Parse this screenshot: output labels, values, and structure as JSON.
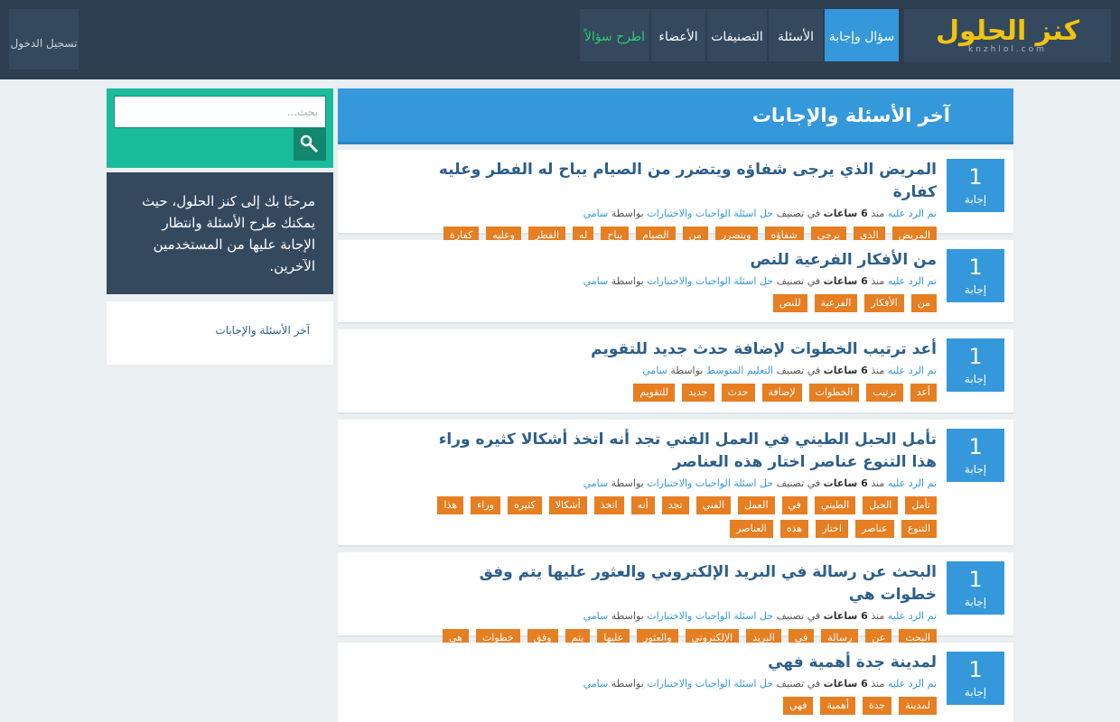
{
  "header": {
    "logo_main": "كنز الحلول",
    "logo_sub": "knzhlol.com",
    "nav": [
      {
        "label": "سؤال وإجابة",
        "icon": "qa-icon",
        "glyph": ""
      },
      {
        "label": "الأسئلة",
        "icon": "questions-icon",
        "glyph": ""
      },
      {
        "label": "التصنيفات",
        "icon": "categories-icon",
        "glyph": ""
      },
      {
        "label": "الأعضاء",
        "icon": "users-icon",
        "glyph": ""
      },
      {
        "label": "اطرح سؤالاً",
        "icon": "ask-icon",
        "glyph": ""
      }
    ],
    "login": {
      "label": "تسجيل الدخول",
      "glyph": ""
    },
    "colors": {
      "bar": "#2c3e50",
      "button": "#34495e",
      "active": "#3498db",
      "ask": "#2ecc71",
      "logo": "#f1c40f"
    }
  },
  "main": {
    "title": "آخر الأسئلة والإجابات",
    "rss_glyph": "",
    "questions": [
      {
        "count": "1",
        "count_label": "إجابة",
        "title": "المريض الذي يرجى شفاؤه ويتضرر من الصيام يباح له الفطر وعليه كفارة",
        "meta": {
          "answered": "تم الرد عليه",
          "since": "منذ",
          "time": "6 ساعات",
          "in_cat": "في تصنيف",
          "category": "حل اسئلة الواجبات والاختبارات",
          "by": "بواسطة",
          "user": "سامي"
        },
        "tags": [
          "المريض",
          "الذي",
          "يرجى",
          "شفاؤه",
          "ويتضرر",
          "من",
          "الصيام",
          "يباح",
          "له",
          "الفطر",
          "وعليه",
          "كفارة"
        ]
      },
      {
        "count": "1",
        "count_label": "إجابة",
        "title": "من الأفكار الفرعية للنص",
        "meta": {
          "answered": "تم الرد عليه",
          "since": "منذ",
          "time": "6 ساعات",
          "in_cat": "في تصنيف",
          "category": "حل اسئلة الواجبات والاختبارات",
          "by": "بواسطة",
          "user": "سامي"
        },
        "tags": [
          "من",
          "الأفكار",
          "الفرعية",
          "للنص"
        ]
      },
      {
        "count": "1",
        "count_label": "إجابة",
        "title": "أعد ترتيب الخطوات لإضافة حدث جديد للتقويم",
        "meta": {
          "answered": "تم الرد عليه",
          "since": "منذ",
          "time": "6 ساعات",
          "in_cat": "في تصنيف",
          "category": "التعليم المتوسط",
          "by": "بواسطة",
          "user": "سامي"
        },
        "tags": [
          "أعد",
          "ترتيب",
          "الخطوات",
          "لإضافة",
          "حدث",
          "جديد",
          "للتقويم"
        ]
      },
      {
        "count": "1",
        "count_label": "إجابة",
        "title": "تأمل الحبل الطيني في العمل الفني تجد أنه اتخذ أشكالا كثيره وراء هذا التنوع عناصر اختار هذه العناصر",
        "meta": {
          "answered": "تم الرد عليه",
          "since": "منذ",
          "time": "6 ساعات",
          "in_cat": "في تصنيف",
          "category": "حل اسئلة الواجبات والاختبارات",
          "by": "بواسطة",
          "user": "سامي"
        },
        "tags": [
          "تأمل",
          "الحبل",
          "الطيني",
          "في",
          "العمل",
          "الفني",
          "تجد",
          "أنه",
          "اتخذ",
          "أشكالا",
          "كثيره",
          "وراء",
          "هذا",
          "التنوع",
          "عناصر",
          "اختار",
          "هذه",
          "العناصر"
        ]
      },
      {
        "count": "1",
        "count_label": "إجابة",
        "title": "البحث عن رسالة في البريد الإلكتروني والعثور عليها يتم وفق خطوات هي",
        "meta": {
          "answered": "تم الرد عليه",
          "since": "منذ",
          "time": "6 ساعات",
          "in_cat": "في تصنيف",
          "category": "حل اسئلة الواجبات والاختبارات",
          "by": "بواسطة",
          "user": "سامي"
        },
        "tags": [
          "البحث",
          "عن",
          "رسالة",
          "في",
          "البريد",
          "الإلكتروني",
          "والعثور",
          "عليها",
          "يتم",
          "وفق",
          "خطوات",
          "هي"
        ]
      },
      {
        "count": "1",
        "count_label": "إجابة",
        "title": "لمدينة جدة أهمية فهي",
        "meta": {
          "answered": "تم الرد عليه",
          "since": "منذ",
          "time": "6 ساعات",
          "in_cat": "في تصنيف",
          "category": "حل اسئلة الواجبات والاختبارات",
          "by": "بواسطة",
          "user": "سامي"
        },
        "tags": [
          "لمدينة",
          "جدة",
          "أهمية",
          "فهي"
        ]
      }
    ]
  },
  "sidebar": {
    "search_placeholder": "بحث...",
    "welcome": "مرحبًا بك إلى كنز الحلول، حيث يمكنك طرح الأسئلة وانتظار الإجابة عليها من المستخدمين الآخرين.",
    "link": "آخر الأسئلة والإجابات",
    "link_glyph": ""
  }
}
